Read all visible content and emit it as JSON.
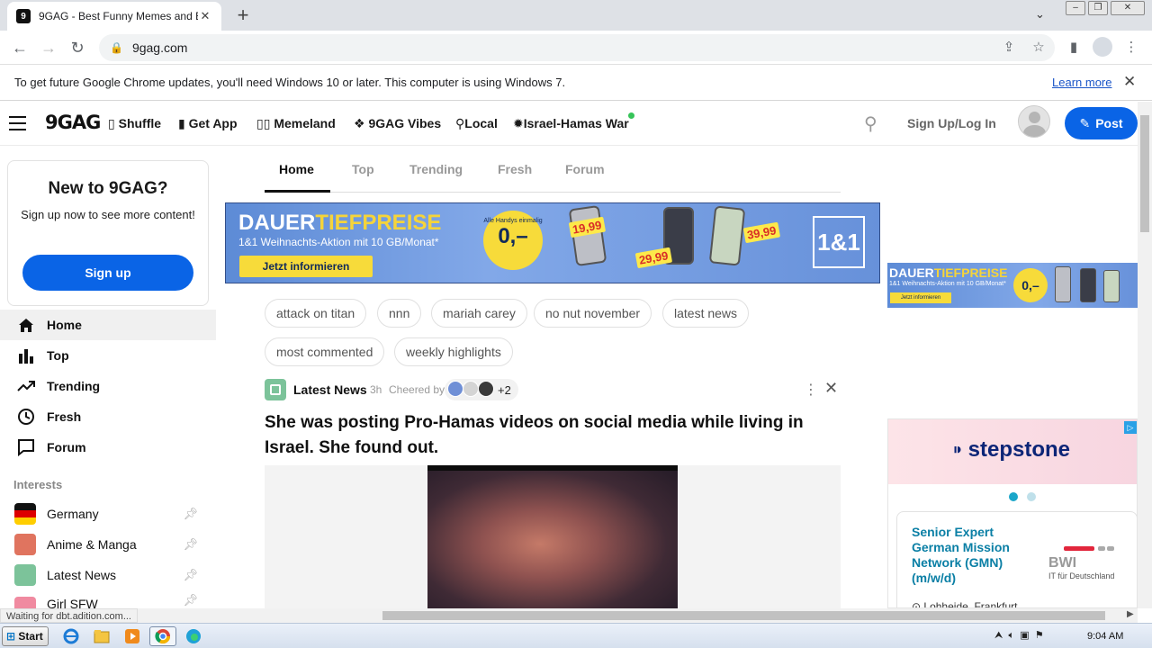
{
  "browser": {
    "tab_title": "9GAG - Best Funny Memes and Breaking News",
    "tab_favicon": "9",
    "url": "9gag.com",
    "infobar_text": "To get future Google Chrome updates, you'll need Windows 10 or later. This computer is using Windows 7.",
    "infobar_link": "Learn more",
    "status_text": "Waiting for dbt.adition.com..."
  },
  "site": {
    "logo": "9GAG",
    "nav": [
      {
        "icon": "dice-icon",
        "label": "Shuffle"
      },
      {
        "icon": "phone-icon",
        "label": "Get App"
      },
      {
        "icon": "memeland-icon",
        "label": "Memeland"
      },
      {
        "icon": "vibes-icon",
        "label": "9GAG Vibes"
      },
      {
        "icon": "pin-icon",
        "label": "Local"
      },
      {
        "icon": "flag-icon",
        "label": "Israel-Hamas War"
      }
    ],
    "login_label": "Sign Up/Log In",
    "post_label": "Post",
    "accent": "#0a64e6"
  },
  "sidebar": {
    "card_title": "New to 9GAG?",
    "card_subtitle": "Sign up now to see more content!",
    "signup_label": "Sign up",
    "items": [
      {
        "icon": "home-icon",
        "label": "Home"
      },
      {
        "icon": "bar-chart-icon",
        "label": "Top"
      },
      {
        "icon": "trending-icon",
        "label": "Trending"
      },
      {
        "icon": "clock-icon",
        "label": "Fresh"
      },
      {
        "icon": "chat-icon",
        "label": "Forum"
      }
    ],
    "interests_label": "Interests",
    "interests": [
      {
        "label": "Germany",
        "color": "#dd0000"
      },
      {
        "label": "Anime & Manga",
        "color": "#e0745f"
      },
      {
        "label": "Latest News",
        "color": "#7cc39a"
      },
      {
        "label": "Girl SFW",
        "color": "#f08aa0"
      }
    ]
  },
  "main": {
    "tabs": [
      "Home",
      "Top",
      "Trending",
      "Fresh",
      "Forum"
    ],
    "banner": {
      "headline_a": "DAUER",
      "headline_b": "TIEFPREISE",
      "subline": "1&1 Weihnachts-Aktion mit 10 GB/Monat*",
      "cta": "Jetzt informieren",
      "circle_small": "Alle Handys einmalig",
      "circle_price": "0,–",
      "prices": [
        "19,99",
        "29,99",
        "39,99"
      ],
      "brand": "1&1"
    },
    "tags": [
      "attack on titan",
      "nnn",
      "mariah carey",
      "no nut november",
      "latest news",
      "most commented",
      "weekly highlights"
    ],
    "post": {
      "category": "Latest News",
      "time": "3h",
      "cheered_by": "Cheered by",
      "cheer_count": "+2",
      "title": "She was posting Pro-Hamas videos on social media while living in Israel. She found out."
    }
  },
  "right_ads": {
    "side_banner_a": "DAUER",
    "side_banner_b": "TIEFPREISE",
    "side_banner_sub": "1&1 Weihnachts-Aktion mit 10 GB/Monat*",
    "side_banner_cta": "Jetzt informieren",
    "side_banner_price": "0,–",
    "stepstone_logo": "stepstone",
    "job_title": "Senior Expert German Mission Network (GMN) (m/w/d)",
    "brand": "BWI",
    "brand_sub": "IT für Deutschland",
    "location": "Lohheide, Frankfurt"
  },
  "taskbar": {
    "start_label": "Start",
    "clock": "9:04 AM"
  }
}
